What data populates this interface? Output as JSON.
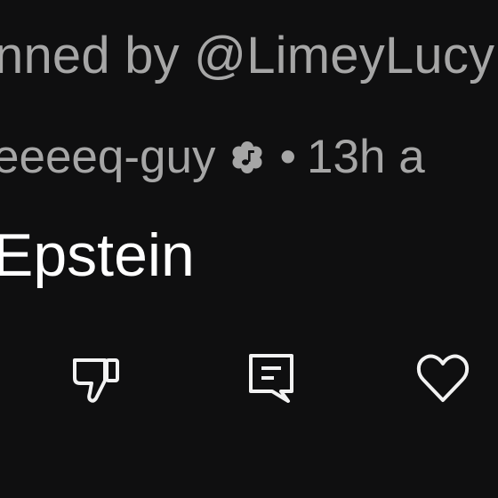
{
  "post": {
    "pinned_text": "nned by @LimeyLucy",
    "author": "eeeeq-guy",
    "separator": "•",
    "timestamp": "13h a",
    "body": "Epstein"
  },
  "icons": {
    "verified": "flower-badge-icon",
    "dislike": "thumbs-down-icon",
    "comment": "comment-icon",
    "like": "heart-icon"
  },
  "colors": {
    "background": "#0f0f10",
    "muted_text": "#a6a6a6",
    "primary_text": "#ffffff"
  }
}
